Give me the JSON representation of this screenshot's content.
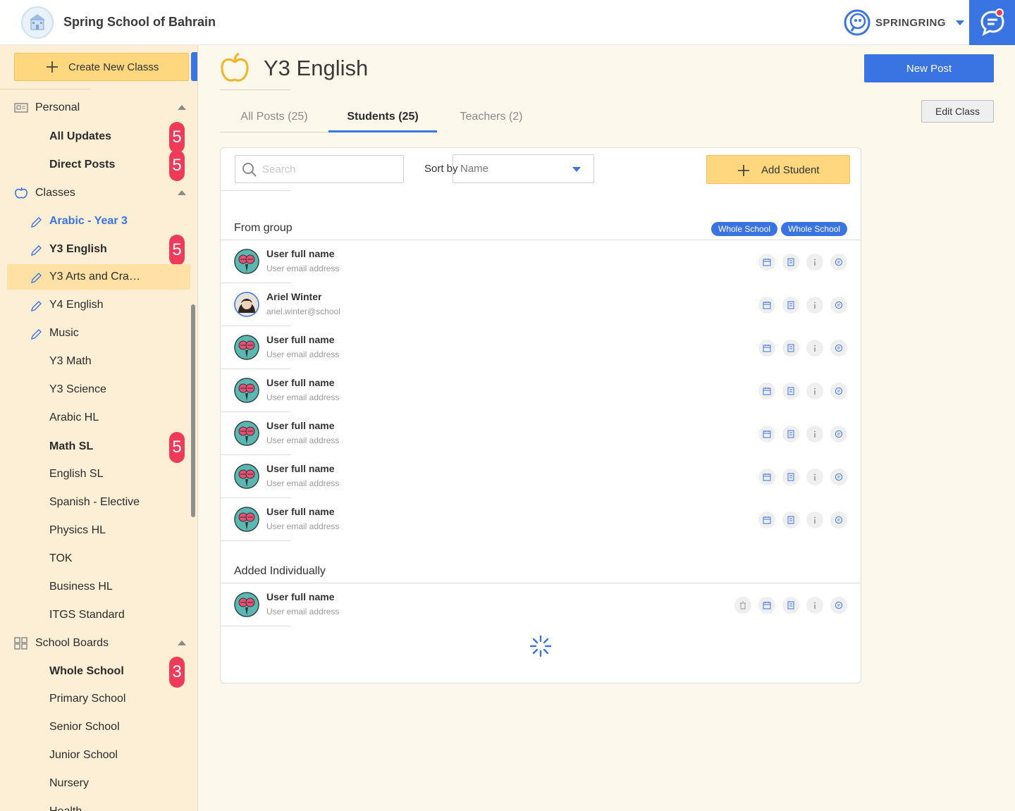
{
  "header": {
    "school_name": "Spring School of Bahrain",
    "brand_name": "SPRINGRING"
  },
  "sidebar": {
    "create_label": "Create New Classs",
    "sections": {
      "personal": "Personal",
      "classes": "Classes",
      "boards": "School Boards"
    },
    "personal_items": [
      {
        "label": "All Updates",
        "badge": "5"
      },
      {
        "label": "Direct Posts",
        "badge": "5"
      }
    ],
    "class_items": [
      {
        "label": "Arabic - Year 3"
      },
      {
        "label": "Y3 English",
        "badge": "5"
      },
      {
        "label": "Y3 Arts and Cra…"
      },
      {
        "label": "Y4 English"
      },
      {
        "label": "Music"
      },
      {
        "label": "Y3 Math"
      },
      {
        "label": "Y3 Science"
      },
      {
        "label": "Arabic HL"
      },
      {
        "label": "Math SL",
        "badge": "5"
      },
      {
        "label": "English SL"
      },
      {
        "label": "Spanish - Elective"
      },
      {
        "label": "Physics HL"
      },
      {
        "label": "TOK"
      },
      {
        "label": "Business HL"
      },
      {
        "label": "ITGS Standard"
      }
    ],
    "board_items": [
      {
        "label": "Whole School",
        "badge": "3"
      },
      {
        "label": "Primary School"
      },
      {
        "label": "Senior School"
      },
      {
        "label": "Junior School"
      },
      {
        "label": "Nursery"
      },
      {
        "label": "Health"
      }
    ]
  },
  "main": {
    "class_title": "Y3 English",
    "new_post_label": "New Post",
    "edit_class_label": "Edit Class",
    "tabs": [
      {
        "label": "All Posts (25)"
      },
      {
        "label": "Students (25)"
      },
      {
        "label": "Teachers (2)"
      }
    ],
    "search_placeholder": "Search",
    "sort_label": "Sort by",
    "sort_value": "Name",
    "add_student_label": "Add Student",
    "group_title": "From group",
    "group_chips": [
      "Whole School",
      "Whole School"
    ],
    "group_students": [
      {
        "name": "User full name",
        "email": "User email address"
      },
      {
        "name": "Ariel Winter",
        "email": "ariel.winter@school"
      },
      {
        "name": "User full name",
        "email": "User email address"
      },
      {
        "name": "User full name",
        "email": "User email address"
      },
      {
        "name": "User full name",
        "email": "User email address"
      },
      {
        "name": "User full name",
        "email": "User email address"
      },
      {
        "name": "User full name",
        "email": "User email address"
      }
    ],
    "individual_title": "Added Individually",
    "individual_students": [
      {
        "name": "User full name",
        "email": "User email address"
      }
    ],
    "action_icons": [
      "calendar-icon",
      "notebook-icon",
      "info-icon",
      "message-icon"
    ],
    "extra_action_icon": "trash-icon"
  },
  "colors": {
    "accent": "#3a74e3",
    "badge": "#ef3b5a",
    "sidebar_bg": "#fdefd6",
    "highlight": "#ffd77e"
  }
}
